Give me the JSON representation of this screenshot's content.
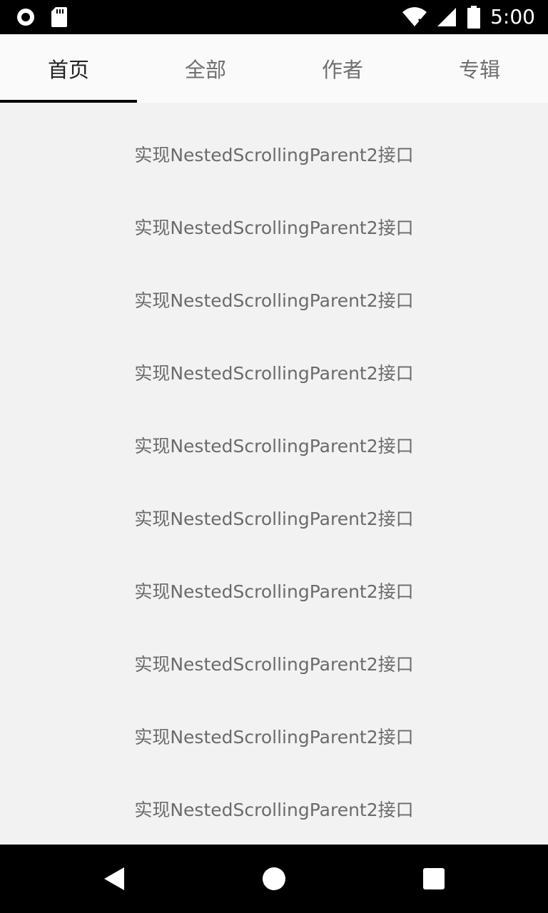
{
  "status_bar": {
    "time": "5:00",
    "icons": [
      "circle-notification-icon",
      "sd-card-icon",
      "wifi-icon",
      "signal-icon",
      "battery-icon"
    ]
  },
  "tabs": [
    {
      "label": "首页",
      "active": true
    },
    {
      "label": "全部",
      "active": false
    },
    {
      "label": "作者",
      "active": false
    },
    {
      "label": "专辑",
      "active": false
    }
  ],
  "list": {
    "items": [
      "实现NestedScrollingParent2接口",
      "实现NestedScrollingParent2接口",
      "实现NestedScrollingParent2接口",
      "实现NestedScrollingParent2接口",
      "实现NestedScrollingParent2接口",
      "实现NestedScrollingParent2接口",
      "实现NestedScrollingParent2接口",
      "实现NestedScrollingParent2接口",
      "实现NestedScrollingParent2接口",
      "实现NestedScrollingParent2接口"
    ]
  },
  "nav_bar": {
    "icons": [
      "back-icon",
      "home-icon",
      "recents-icon"
    ]
  },
  "colors": {
    "tab_active_text": "#222222",
    "tab_inactive_text": "#707070",
    "indicator": "#000000",
    "list_text": "#6b6b6b",
    "background": "#f2f2f2"
  }
}
